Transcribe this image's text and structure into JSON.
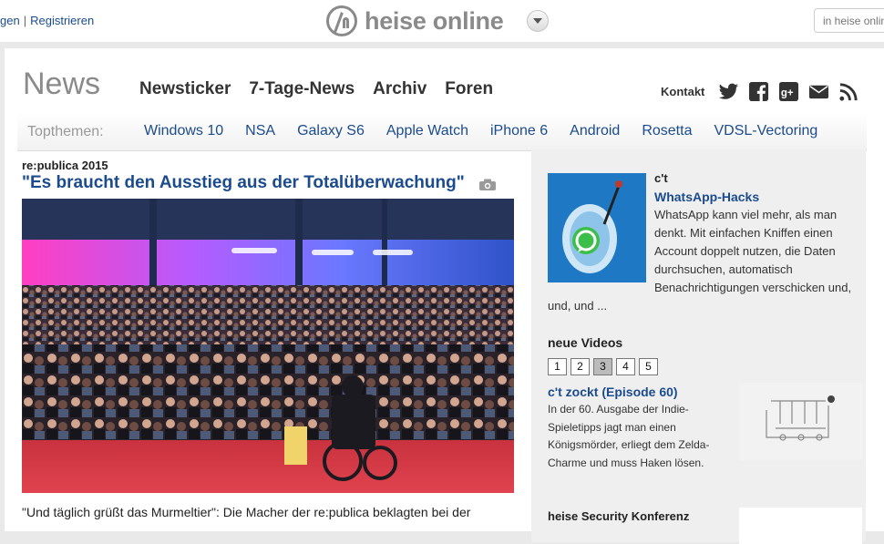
{
  "top": {
    "login_label": "gen",
    "separator": "|",
    "register_label": "Registrieren",
    "logo_text": "heise online",
    "search_placeholder": "in heise online"
  },
  "header": {
    "section_title": "News",
    "nav": [
      "Newsticker",
      "7-Tage-News",
      "Archiv",
      "Foren"
    ],
    "kontakt_label": "Kontakt",
    "social_icons": [
      "twitter-icon",
      "facebook-icon",
      "google-plus-icon",
      "mail-icon",
      "rss-icon"
    ]
  },
  "topthemen": {
    "label": "Topthemen:",
    "items": [
      "Windows 10",
      "NSA",
      "Galaxy S6",
      "Apple Watch",
      "iPhone 6",
      "Android",
      "Rosetta",
      "VDSL-Vectoring"
    ]
  },
  "article": {
    "kicker": "re:publica 2015",
    "headline": "\"Es braucht den Ausstieg aus der Totalüberwachung\"",
    "teaser": "\"Und täglich grüßt das Murmeltier\": Die Macher der re:publica beklagten bei der"
  },
  "sidebar": {
    "ct": {
      "kicker": "c't",
      "title": "WhatsApp-Hacks",
      "text": "WhatsApp kann viel mehr, als man denkt. Mit einfachen Kniffen einen Account doppelt nutzen, die Daten durchsuchen, automatisch Benachrichtigungen verschicken und,",
      "text_cont": "und, und ..."
    },
    "videos": {
      "heading": "neue Videos",
      "pages": [
        "1",
        "2",
        "3",
        "4",
        "5"
      ],
      "active_page": "3",
      "title": "c't zockt (Episode 60)",
      "text": "In der 60. Ausgabe der Indie-Spieletipps jagt man einen Königsmörder, erliegt dem Zelda-Charme und muss Haken lösen."
    },
    "security": {
      "heading": "heise Security Konferenz"
    }
  },
  "colors": {
    "link_blue": "#1b4b8f",
    "logo_gray": "#8a8a8a",
    "page_bg": "#e9e9e9"
  }
}
